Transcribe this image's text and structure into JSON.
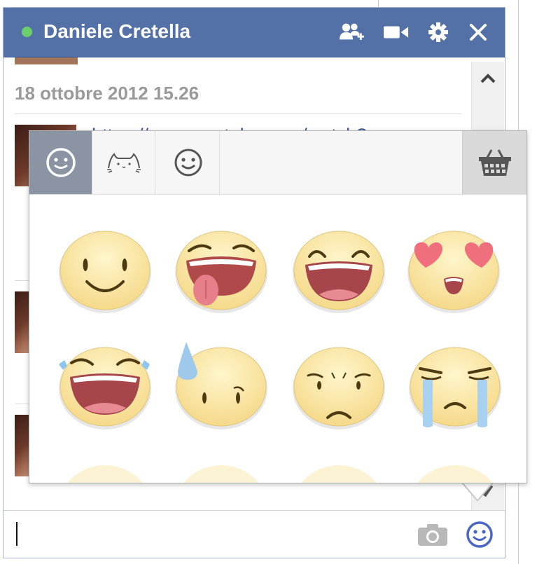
{
  "chat": {
    "contact_name": "Daniele Cretella",
    "status": "online",
    "timestamp": "18 ottobre 2012 15.26",
    "link_text": "https://www.youtube.com/watch?",
    "header_icons": [
      "add-friend-icon",
      "video-call-icon",
      "gear-icon",
      "close-icon"
    ]
  },
  "sticker_picker": {
    "tabs": [
      {
        "icon": "smiley-sticker-pack-icon",
        "active": true
      },
      {
        "icon": "cat-sticker-pack-icon",
        "active": false
      },
      {
        "icon": "emoticon-pack-icon",
        "active": false
      }
    ],
    "store_icon": "sticker-store-basket-icon",
    "stickers": [
      "smiling-face-sticker",
      "tongue-out-face-sticker",
      "grinning-face-sticker",
      "heart-eyes-face-sticker",
      "tears-of-joy-face-sticker",
      "sweat-drop-face-sticker",
      "worried-face-sticker",
      "crying-face-sticker"
    ]
  },
  "input": {
    "value": "",
    "icons": [
      "camera-icon",
      "emoticon-icon"
    ]
  },
  "colors": {
    "header": "#5471a7",
    "online": "#6bd06b",
    "link": "#3b5998",
    "sticker_face": "#fbe7a4"
  }
}
